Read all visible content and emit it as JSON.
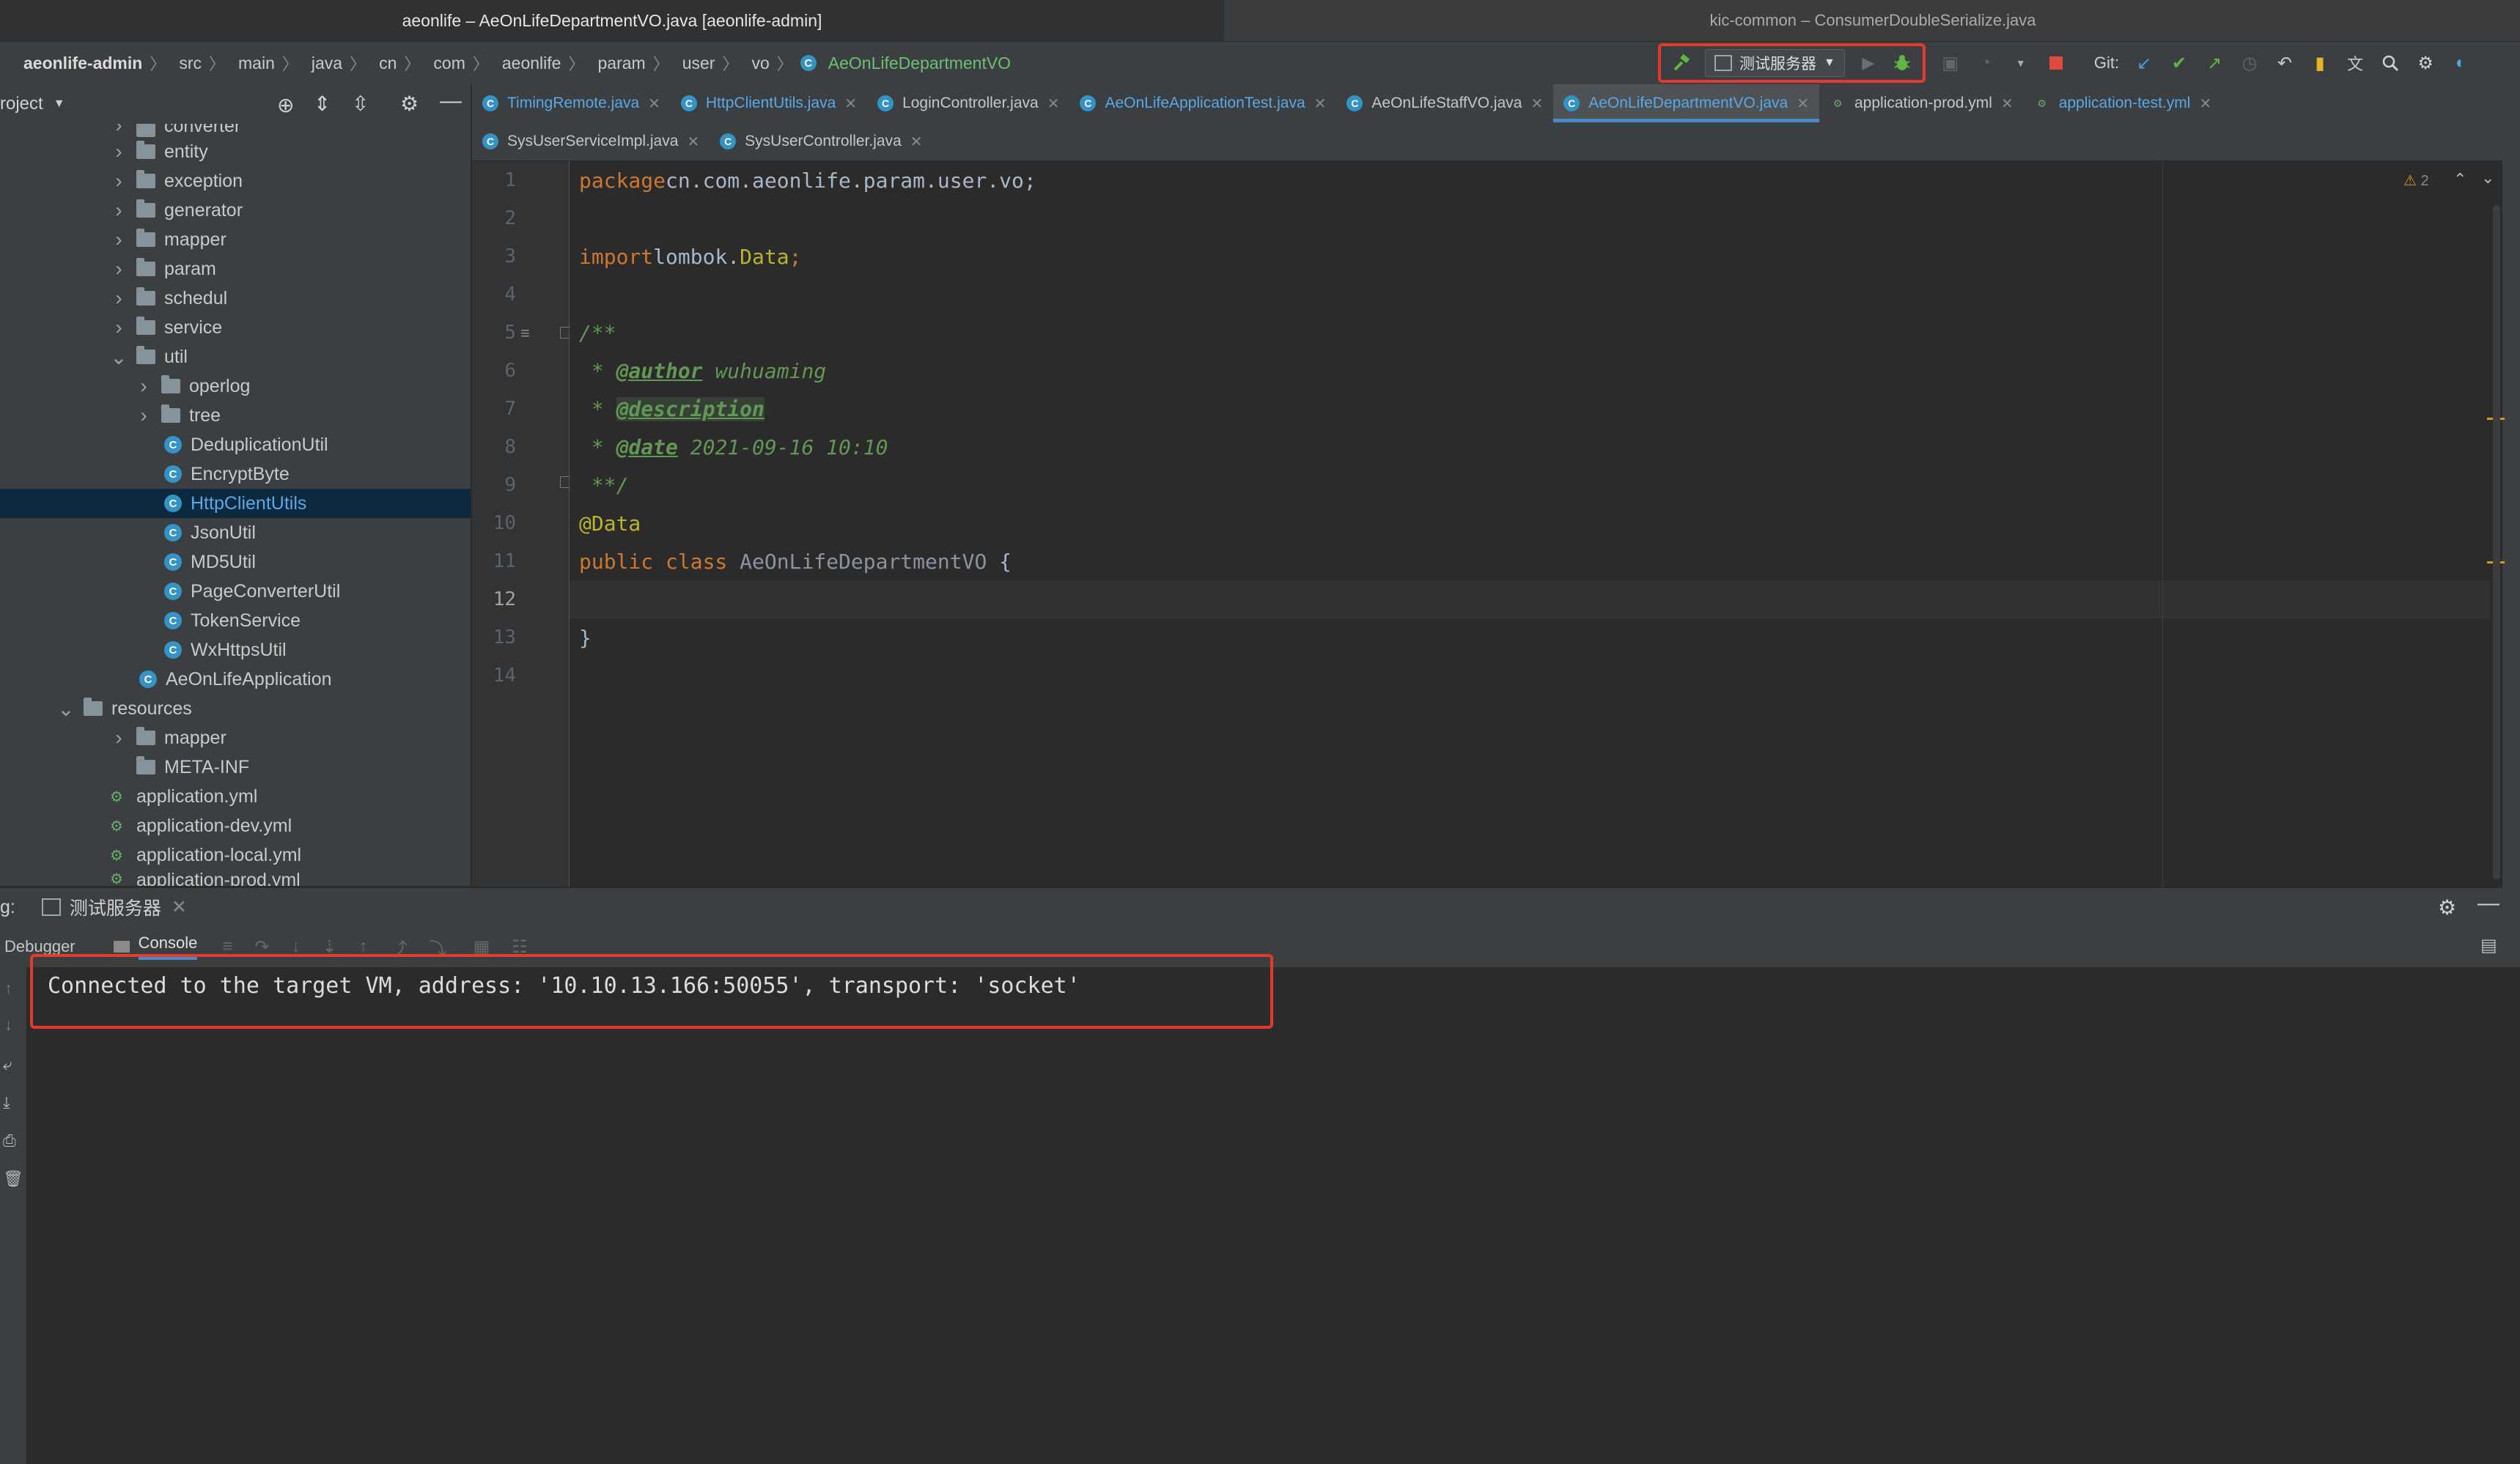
{
  "window": {
    "left_title": "aeonlife – AeOnLifeDepartmentVO.java [aeonlife-admin]",
    "right_title": "kic-common – ConsumerDoubleSerialize.java"
  },
  "breadcrumb": [
    "aeonlife-admin",
    "src",
    "main",
    "java",
    "cn",
    "com",
    "aeonlife",
    "param",
    "user",
    "vo",
    "AeOnLifeDepartmentVO"
  ],
  "toolbar": {
    "run_config": "测试服务器",
    "git_label": "Git:",
    "colors": {
      "highlight_box": "#e5392a",
      "build": "#62b543",
      "debug": "#62b543",
      "stop": "#e04a3f"
    }
  },
  "project": {
    "header": "roject",
    "tree": [
      {
        "label": "converter",
        "type": "folder",
        "depth": 2,
        "expanded": false
      },
      {
        "label": "entity",
        "type": "folder",
        "depth": 2,
        "expanded": false
      },
      {
        "label": "exception",
        "type": "folder",
        "depth": 2,
        "expanded": false
      },
      {
        "label": "generator",
        "type": "folder",
        "depth": 2,
        "expanded": false
      },
      {
        "label": "mapper",
        "type": "folder",
        "depth": 2,
        "expanded": false
      },
      {
        "label": "param",
        "type": "folder",
        "depth": 2,
        "expanded": false
      },
      {
        "label": "schedul",
        "type": "folder",
        "depth": 2,
        "expanded": false
      },
      {
        "label": "service",
        "type": "folder",
        "depth": 2,
        "expanded": false
      },
      {
        "label": "util",
        "type": "folder",
        "depth": 2,
        "expanded": true
      },
      {
        "label": "operlog",
        "type": "folder",
        "depth": 3,
        "expanded": false
      },
      {
        "label": "tree",
        "type": "folder",
        "depth": 3,
        "expanded": false
      },
      {
        "label": "DeduplicationUtil",
        "type": "class",
        "depth": 3
      },
      {
        "label": "EncryptByte",
        "type": "class",
        "depth": 3
      },
      {
        "label": "HttpClientUtils",
        "type": "class",
        "depth": 3,
        "selected": true
      },
      {
        "label": "JsonUtil",
        "type": "class",
        "depth": 3
      },
      {
        "label": "MD5Util",
        "type": "class",
        "depth": 3
      },
      {
        "label": "PageConverterUtil",
        "type": "class",
        "depth": 3
      },
      {
        "label": "TokenService",
        "type": "class",
        "depth": 3
      },
      {
        "label": "WxHttpsUtil",
        "type": "class",
        "depth": 3
      },
      {
        "label": "AeOnLifeApplication",
        "type": "class",
        "depth": 2
      },
      {
        "label": "resources",
        "type": "folder",
        "depth": 1,
        "expanded": true
      },
      {
        "label": "mapper",
        "type": "folder",
        "depth": 2,
        "expanded": false
      },
      {
        "label": "META-INF",
        "type": "folder",
        "depth": 2,
        "noarrow": true
      },
      {
        "label": "application.yml",
        "type": "yml",
        "depth": 2
      },
      {
        "label": "application-dev.yml",
        "type": "yml",
        "depth": 2
      },
      {
        "label": "application-local.yml",
        "type": "yml",
        "depth": 2
      },
      {
        "label": "application-prod.yml",
        "type": "yml",
        "depth": 2
      }
    ]
  },
  "tabs_row1": [
    {
      "label": "TimingRemote.java",
      "style": "blue"
    },
    {
      "label": "HttpClientUtils.java",
      "style": "blue"
    },
    {
      "label": "LoginController.java",
      "style": "normal"
    },
    {
      "label": "AeOnLifeApplicationTest.java",
      "style": "blue"
    },
    {
      "label": "AeOnLifeStaffVO.java",
      "style": "normal"
    },
    {
      "label": "AeOnLifeDepartmentVO.java",
      "style": "blue",
      "active": true
    },
    {
      "label": "application-prod.yml",
      "style": "normal",
      "yml": true
    },
    {
      "label": "application-test.yml",
      "style": "blue",
      "yml": true
    }
  ],
  "tabs_row2": [
    {
      "label": "SysUserServiceImpl.java",
      "style": "normal"
    },
    {
      "label": "SysUserController.java",
      "style": "normal"
    }
  ],
  "editor": {
    "warning_count": "2",
    "line_numbers": [
      "1",
      "2",
      "3",
      "4",
      "5",
      "6",
      "7",
      "8",
      "9",
      "10",
      "11",
      "12",
      "13",
      "14"
    ],
    "current_line": "12",
    "code": {
      "l1_kw": "package",
      "l1_rest": " cn.com.aeonlife.param.user.vo;",
      "l3_kw": "import",
      "l3_pkg": " lombok.",
      "l3_cls": "Data",
      "l3_end": ";",
      "l5": "/**",
      "l6_star": " * ",
      "l6_tag": "@author",
      "l6_val": " wuhuaming",
      "l7_star": " * ",
      "l7_tag": "@description",
      "l8_star": " * ",
      "l8_tag": "@date",
      "l8_val": " 2021-09-16 10:10",
      "l9": " **/",
      "l10": "@Data",
      "l11_kw": "public class",
      "l11_name": " AeOnLifeDepartmentVO",
      "l11_end": " {",
      "l13": "}"
    }
  },
  "debug": {
    "label_prefix": "g:",
    "run_tab": "测试服务器",
    "tab_debugger": "Debugger",
    "tab_console": "Console",
    "console_line": "Connected to the target VM, address: '10.10.13.166:50055', transport: 'socket'"
  }
}
